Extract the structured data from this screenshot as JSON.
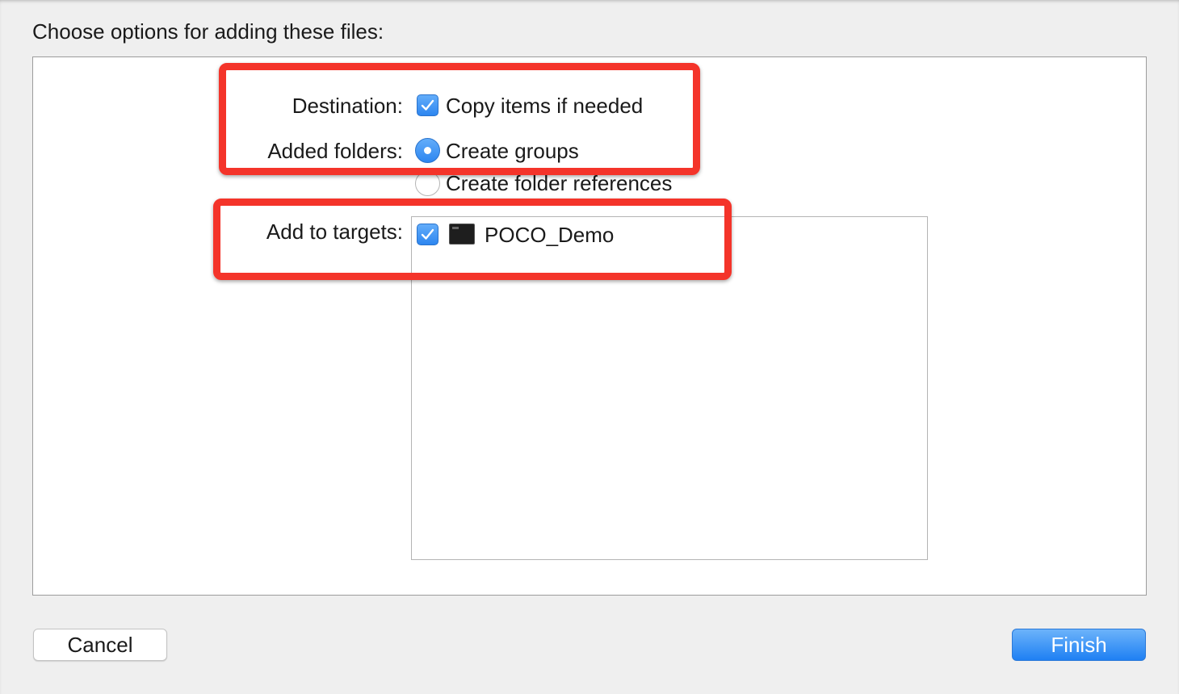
{
  "dialog": {
    "heading": "Choose options for adding these files:"
  },
  "destination": {
    "label": "Destination:",
    "copy_items": {
      "text": "Copy items if needed",
      "checked": true
    }
  },
  "added_folders": {
    "label": "Added folders:",
    "options": [
      {
        "text": "Create groups",
        "selected": true
      },
      {
        "text": "Create folder references",
        "selected": false
      }
    ]
  },
  "targets": {
    "label": "Add to targets:",
    "items": [
      {
        "name": "POCO_Demo",
        "checked": true,
        "icon": "terminal-app-icon"
      }
    ]
  },
  "buttons": {
    "cancel": "Cancel",
    "finish": "Finish"
  },
  "colors": {
    "accent": "#2d86f0",
    "highlight": "#f4342a",
    "background": "#efefef"
  }
}
